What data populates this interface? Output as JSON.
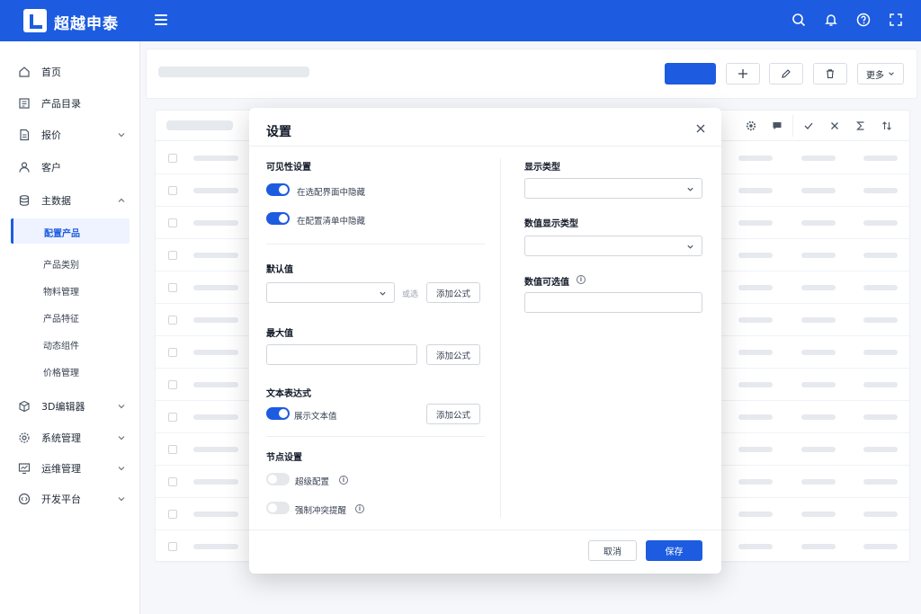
{
  "brand": {
    "name": "超越申泰"
  },
  "sidebar": {
    "items": [
      {
        "label": "首页",
        "icon": "home-icon"
      },
      {
        "label": "产品目录",
        "icon": "catalog-icon"
      },
      {
        "label": "报价",
        "icon": "quote-icon",
        "expandable": true
      },
      {
        "label": "客户",
        "icon": "user-icon"
      },
      {
        "label": "主数据",
        "icon": "database-icon",
        "expanded": true
      },
      {
        "label": "3D编辑器",
        "icon": "cube-icon",
        "expandable": true
      },
      {
        "label": "系统管理",
        "icon": "gear-icon",
        "expandable": true
      },
      {
        "label": "运维管理",
        "icon": "monitor-icon",
        "expandable": true
      },
      {
        "label": "开发平台",
        "icon": "code-icon",
        "expandable": true
      }
    ],
    "sub_items": [
      "配置产品",
      "产品类别",
      "物料管理",
      "产品特征",
      "动态组件",
      "价格管理"
    ],
    "active_sub": "配置产品"
  },
  "toolbar": {
    "more_label": "更多"
  },
  "modal": {
    "title": "设置",
    "visibility": {
      "title": "可见性设置",
      "hide_in_config": "在选配界面中隐藏",
      "hide_in_list": "在配置清单中隐藏"
    },
    "default_value": {
      "title": "默认值",
      "or_label": "或选",
      "formula_btn": "添加公式"
    },
    "max_value": {
      "title": "最大值",
      "formula_btn": "添加公式"
    },
    "text_expr": {
      "title": "文本表达式",
      "show_text": "展示文本值",
      "formula_btn": "添加公式"
    },
    "node_settings": {
      "title": "节点设置",
      "super_config": "超级配置",
      "force_conflict": "强制冲突提醒"
    },
    "display_type": {
      "title": "显示类型"
    },
    "number_display_type": {
      "title": "数值显示类型"
    },
    "number_options": {
      "title": "数值可选值"
    },
    "cancel_label": "取消",
    "save_label": "保存"
  },
  "colors": {
    "primary": "#1d5ce0"
  }
}
